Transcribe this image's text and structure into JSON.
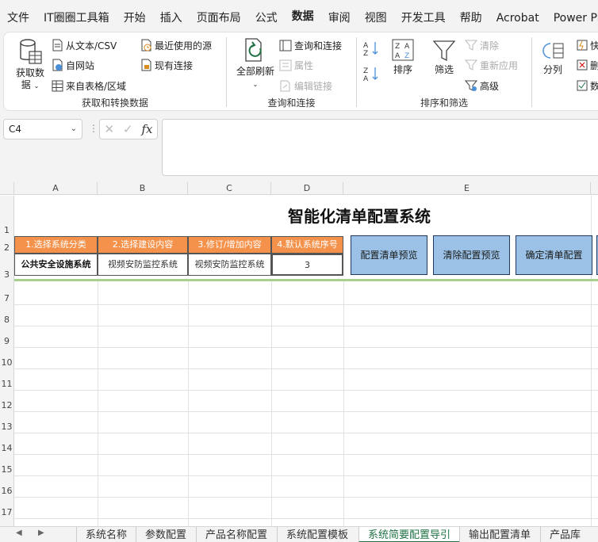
{
  "menu": {
    "items": [
      "文件",
      "IT圈圈工具箱",
      "开始",
      "插入",
      "页面布局",
      "公式",
      "数据",
      "审阅",
      "视图",
      "开发工具",
      "帮助",
      "Acrobat",
      "Power Pivot"
    ],
    "active_index": 6
  },
  "ribbon": {
    "get_transform": {
      "label": "获取和转换数据",
      "get_data": "获取数\n据",
      "from_text_csv": "从文本/CSV",
      "from_web": "自网站",
      "from_table": "来自表格/区域",
      "recent_sources": "最近使用的源",
      "existing_connections": "现有连接"
    },
    "queries": {
      "label": "查询和连接",
      "refresh_all": "全部刷新",
      "queries_connections": "查询和连接",
      "properties": "属性",
      "edit_links": "编辑链接"
    },
    "sort_filter": {
      "label": "排序和筛选",
      "sort": "排序",
      "filter": "筛选",
      "clear": "清除",
      "reapply": "重新应用",
      "advanced": "高级"
    },
    "data_tools": {
      "text_to_columns": "分列",
      "flash_fill": "快",
      "remove_duplicates": "删",
      "validation": "数"
    }
  },
  "formula_bar": {
    "name_box": "C4",
    "fx": "fx",
    "content": ""
  },
  "sheet": {
    "columns": [
      "A",
      "B",
      "C",
      "D",
      "E"
    ],
    "rows": [
      "1",
      "2",
      "3",
      "7",
      "8",
      "9",
      "10",
      "11",
      "12",
      "13",
      "14",
      "15",
      "16",
      "17"
    ],
    "title": "智能化清单配置系统",
    "headers": [
      "1.选择系统分类",
      "2.选择建设内容",
      "3.修订/增加内容",
      "4.默认系统序号"
    ],
    "values": [
      "公共安全设施系统",
      "视频安防监控系统",
      "视频安防监控系统",
      "3"
    ],
    "buttons": [
      "配置清单预览",
      "清除配置预览",
      "确定清单配置"
    ]
  },
  "tabs": {
    "items": [
      "系统名称",
      "参数配置",
      "产品名称配置",
      "系统配置模板",
      "系统简要配置导引",
      "输出配置清单",
      "产品库"
    ],
    "active_index": 4
  },
  "colors": {
    "accent": "#217346",
    "header_orange": "#f4914a",
    "button_blue": "#9bc2e6",
    "divider_green": "#a9d08e"
  }
}
